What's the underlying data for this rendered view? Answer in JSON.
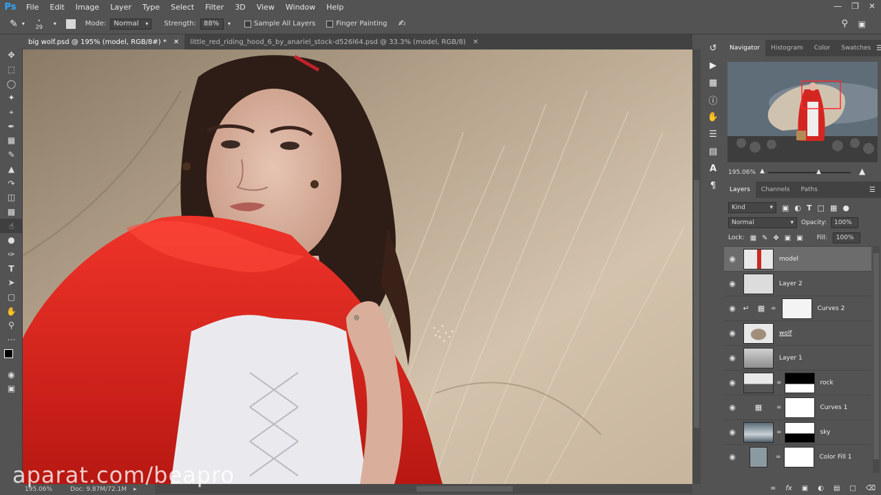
{
  "app": {
    "logo": "Ps"
  },
  "menu": [
    "File",
    "Edit",
    "Image",
    "Layer",
    "Type",
    "Select",
    "Filter",
    "3D",
    "View",
    "Window",
    "Help"
  ],
  "options": {
    "brush_size": "29",
    "mode_label": "Mode:",
    "mode_value": "Normal",
    "strength_label": "Strength:",
    "strength_value": "88%",
    "sample_all_layers": "Sample All Layers",
    "finger_painting": "Finger Painting"
  },
  "tabs": [
    {
      "label": "big wolf.psd @ 195% (model, RGB/8#) *",
      "active": true
    },
    {
      "label": "little_red_riding_hood_6_by_anariel_stock-d526l64.psd @ 33.3% (model, RGB/8)",
      "active": false
    }
  ],
  "status": {
    "zoom": "195.06%",
    "doc": "Doc: 9.87M/72.1M"
  },
  "navigator": {
    "tabs": [
      "Navigator",
      "Histogram",
      "Color",
      "Swatches"
    ],
    "zoom": "195.06%"
  },
  "layers_panel": {
    "tabs": [
      "Layers",
      "Channels",
      "Paths"
    ],
    "filter_kind": "Kind",
    "blend_mode": "Normal",
    "opacity_label": "Opacity:",
    "opacity_value": "100%",
    "lock_label": "Lock:",
    "fill_label": "Fill:",
    "fill_value": "100%",
    "layers": [
      {
        "name": "model",
        "selected": true
      },
      {
        "name": "Layer 2",
        "selected": false
      },
      {
        "name": "Curves 2",
        "selected": false
      },
      {
        "name": "wolf",
        "selected": false
      },
      {
        "name": "Layer 1",
        "selected": false
      },
      {
        "name": "rock",
        "selected": false
      },
      {
        "name": "Curves 1",
        "selected": false
      },
      {
        "name": "sky",
        "selected": false
      },
      {
        "name": "Color Fill 1",
        "selected": false
      }
    ]
  },
  "watermark": "aparat.com/beapro",
  "colors": {
    "accent": "#31a8ff",
    "panel": "#535353",
    "cloak": "#e0261f"
  }
}
